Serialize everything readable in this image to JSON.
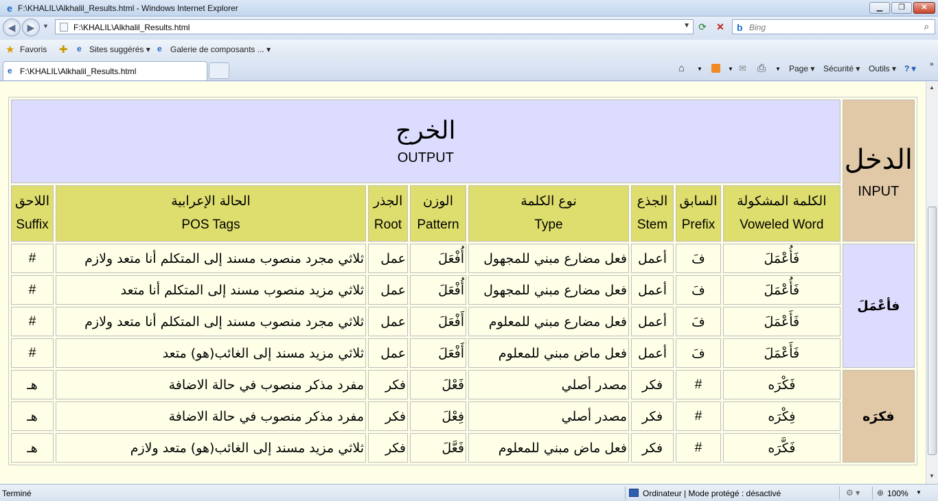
{
  "window": {
    "title": "F:\\KHALIL\\Alkhalil_Results.html - Windows Internet Explorer"
  },
  "address": {
    "url": "F:\\KHALIL\\Alkhalil_Results.html"
  },
  "search": {
    "placeholder": "Bing"
  },
  "favorites": {
    "favoris": "Favoris",
    "sites": "Sites suggérés ▾",
    "galerie": "Galerie de composants ... ▾"
  },
  "tab": {
    "title": "F:\\KHALIL\\Alkhalil_Results.html"
  },
  "commandbar": {
    "page": "Page ▾",
    "securite": "Sécurité ▾",
    "outils": "Outils ▾",
    "help": "? ▾"
  },
  "table": {
    "output_ar": "الخرج",
    "output_en": "OUTPUT",
    "input_ar": "الدخل",
    "input_en": "INPUT",
    "columns": [
      {
        "ar": "اللاحق",
        "en": "Suffix"
      },
      {
        "ar": "الحالة الإعرابية",
        "en": "POS Tags"
      },
      {
        "ar": "الجذر",
        "en": "Root"
      },
      {
        "ar": "الوزن",
        "en": "Pattern"
      },
      {
        "ar": "نوع الكلمة",
        "en": "Type"
      },
      {
        "ar": "الجذع",
        "en": "Stem"
      },
      {
        "ar": "السابق",
        "en": "Prefix"
      },
      {
        "ar": "الكلمة المشكولة",
        "en": "Voweled Word"
      }
    ],
    "groups": [
      {
        "input": "فأعْمَلَ",
        "rows": [
          {
            "suffix": "#",
            "pos": "ثلاثي مجرد منصوب مسند إلى المتكلم أنا متعد ولازم",
            "root": "عمل",
            "pattern": "أُفْعَلَ",
            "type": "فعل مضارع مبني للمجهول",
            "stem": "أعمل",
            "prefix": "فَ",
            "voweled": "فَأُعْمَلَ"
          },
          {
            "suffix": "#",
            "pos": "ثلاثي مزيد منصوب مسند إلى المتكلم أنا متعد",
            "root": "عمل",
            "pattern": "أُفْعَلَ",
            "type": "فعل مضارع مبني للمجهول",
            "stem": "أعمل",
            "prefix": "فَ",
            "voweled": "فَأُعْمَلَ"
          },
          {
            "suffix": "#",
            "pos": "ثلاثي مجرد منصوب مسند إلى المتكلم أنا متعد ولازم",
            "root": "عمل",
            "pattern": "أَفْعَلَ",
            "type": "فعل مضارع مبني للمعلوم",
            "stem": "أعمل",
            "prefix": "فَ",
            "voweled": "فَأَعْمَلَ"
          },
          {
            "suffix": "#",
            "pos": "ثلاثي مزيد مسند إلى الغائب(هو) متعد",
            "root": "عمل",
            "pattern": "أَفْعَلَ",
            "type": "فعل ماض مبني للمعلوم",
            "stem": "أعمل",
            "prefix": "فَ",
            "voweled": "فَأَعْمَلَ"
          }
        ]
      },
      {
        "input": "فكرَه",
        "rows": [
          {
            "suffix": "هـ",
            "pos": "مفرد مذكر منصوب في حالة الاضافة",
            "root": "فكر",
            "pattern": "فَعْلَ",
            "type": "مصدر أصلي",
            "stem": "فكر",
            "prefix": "#",
            "voweled": "فَكْرَه"
          },
          {
            "suffix": "هـ",
            "pos": "مفرد مذكر منصوب في حالة الاضافة",
            "root": "فكر",
            "pattern": "فِعْلَ",
            "type": "مصدر أصلي",
            "stem": "فكر",
            "prefix": "#",
            "voweled": "فِكْرَه"
          },
          {
            "suffix": "هـ",
            "pos": "ثلاثي مزيد مسند إلى الغائب(هو) متعد ولازم",
            "root": "فكر",
            "pattern": "فَعَّلَ",
            "type": "فعل ماض مبني للمعلوم",
            "stem": "فكر",
            "prefix": "#",
            "voweled": "فَكَّرَه"
          }
        ]
      }
    ]
  },
  "status": {
    "left": "Terminé",
    "zone": "Ordinateur | Mode protégé : désactivé",
    "zoom": "100%"
  }
}
